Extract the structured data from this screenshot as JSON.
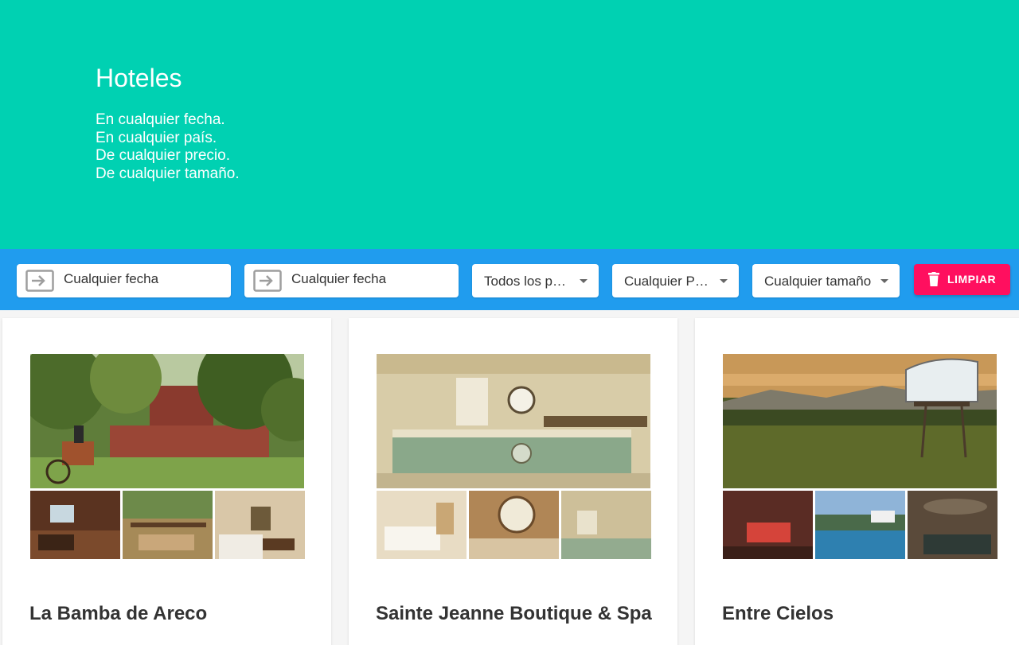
{
  "hero": {
    "title": "Hoteles",
    "lines": [
      "En cualquier fecha.",
      "En cualquier país.",
      "De cualquier precio.",
      "De cualquier tamaño."
    ]
  },
  "filters": {
    "date_from": {
      "value": "Cualquier fecha",
      "icon": "date-range-icon"
    },
    "date_to": {
      "value": "Cualquier fecha",
      "icon": "date-range-icon"
    },
    "country": {
      "value": "Todos los p…"
    },
    "price": {
      "value": "Cualquier P…"
    },
    "size": {
      "value": "Cualquier tamaño"
    },
    "clear_button": {
      "label": "LIMPIAR",
      "icon": "trash-icon"
    }
  },
  "hotels": [
    {
      "name": "La Bamba de Areco"
    },
    {
      "name": "Sainte Jeanne Boutique & Spa"
    },
    {
      "name": "Entre Cielos"
    }
  ],
  "colors": {
    "hero_bg": "#00d1b2",
    "filterbar_bg": "#209cee",
    "clear_button": "#ff0f5f"
  }
}
